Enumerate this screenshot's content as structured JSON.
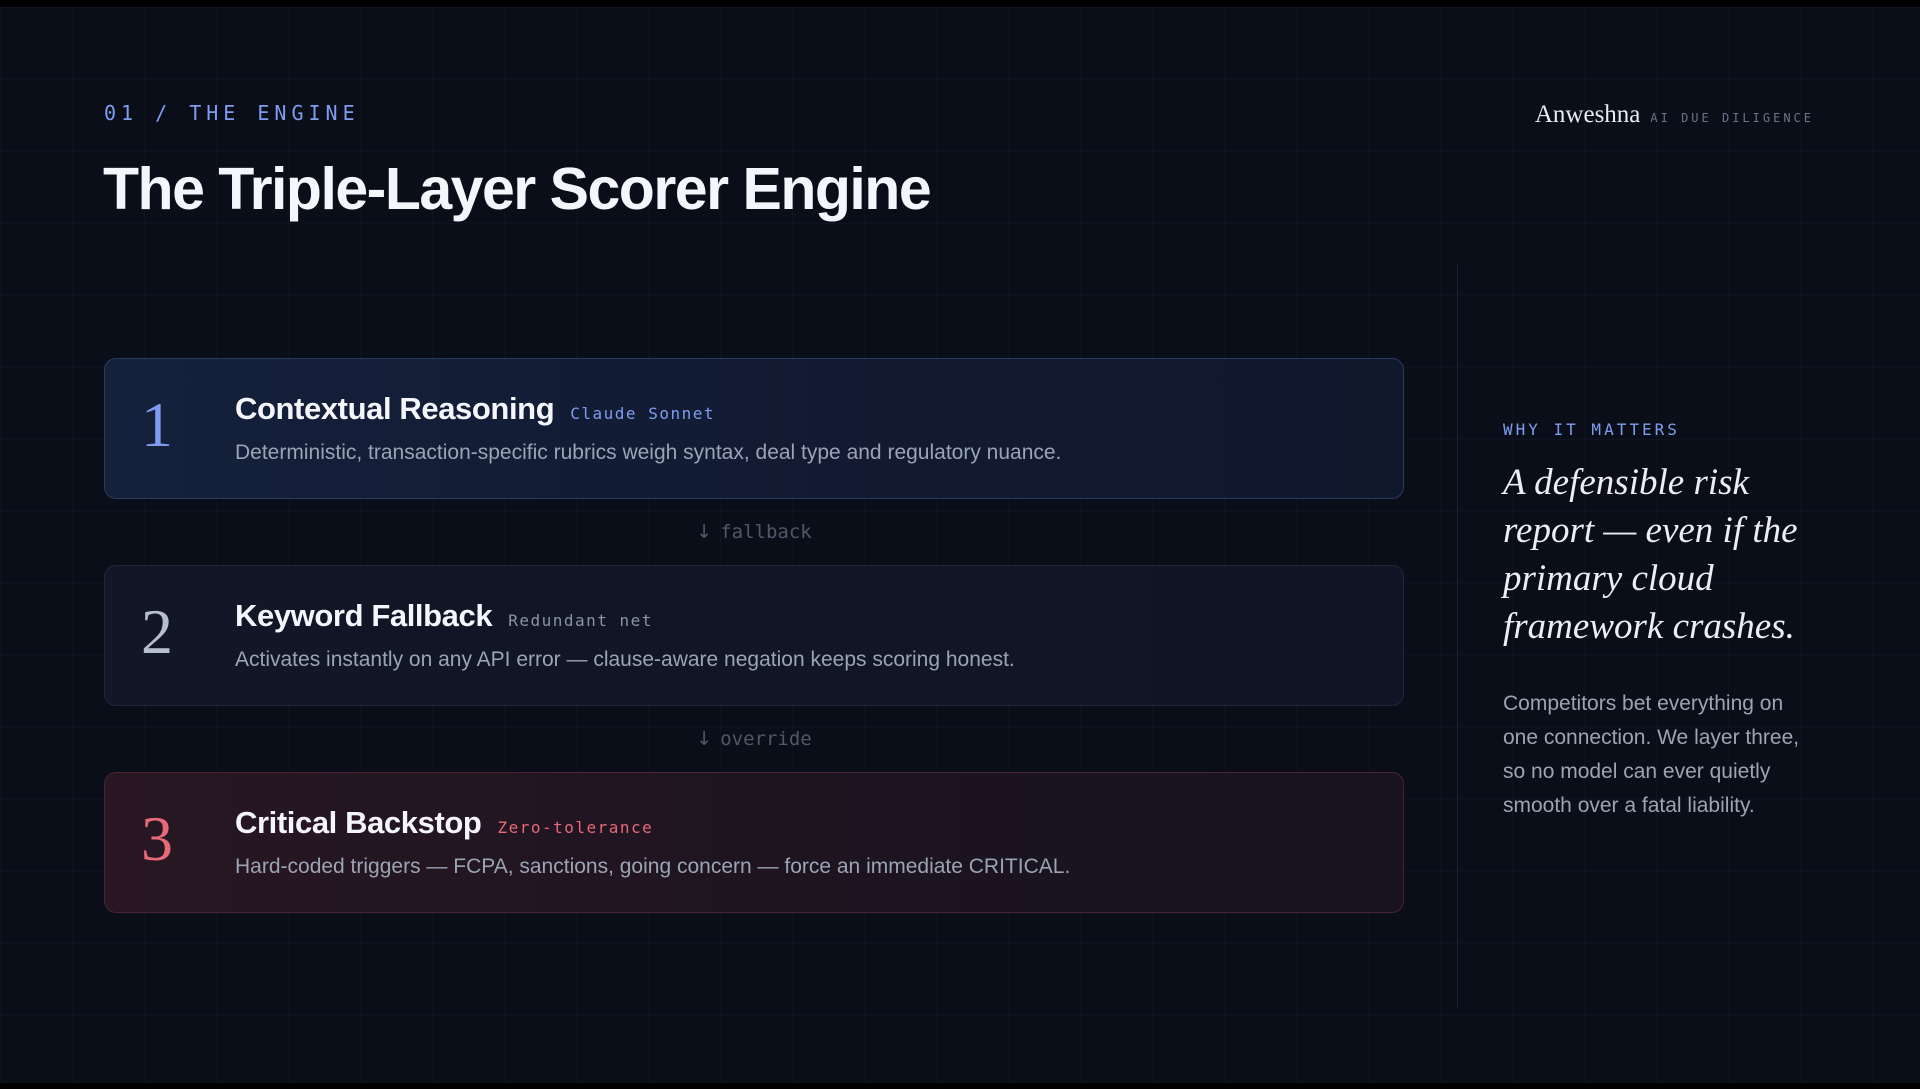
{
  "header": {
    "eyebrow": "01 / THE ENGINE",
    "title": "The Triple-Layer Scorer Engine"
  },
  "brand": {
    "name": "Anweshna",
    "tagline": "AI DUE DILIGENCE"
  },
  "layers": [
    {
      "number": "1",
      "title": "Contextual Reasoning",
      "tag": "Claude Sonnet",
      "description": "Deterministic, transaction-specific rubrics weigh syntax, deal type and regulatory nuance.",
      "accent_color": "#7f9df0"
    },
    {
      "number": "2",
      "title": "Keyword Fallback",
      "tag": "Redundant net",
      "description": "Activates instantly on any API error — clause-aware negation keeps scoring honest.",
      "accent_color": "#b7bfce"
    },
    {
      "number": "3",
      "title": "Critical Backstop",
      "tag": "Zero-tolerance",
      "description": "Hard-coded triggers — FCPA, sanctions, going concern — force an immediate CRITICAL.",
      "accent_color": "#e8697a"
    }
  ],
  "connectors": [
    {
      "icon": "arrow-down-icon",
      "arrow": "↓",
      "label": "fallback"
    },
    {
      "icon": "arrow-down-icon",
      "arrow": "↓",
      "label": "override"
    }
  ],
  "aside": {
    "label": "WHY IT MATTERS",
    "quote": "A defensible risk report — even if the primary cloud framework crashes.",
    "body": "Competitors bet everything on one connection. We layer three, so no model can ever quietly smooth over a fatal liability."
  },
  "colors": {
    "background": "#0a0e19",
    "accent": "#7f9df0",
    "critical": "#e8697a"
  }
}
